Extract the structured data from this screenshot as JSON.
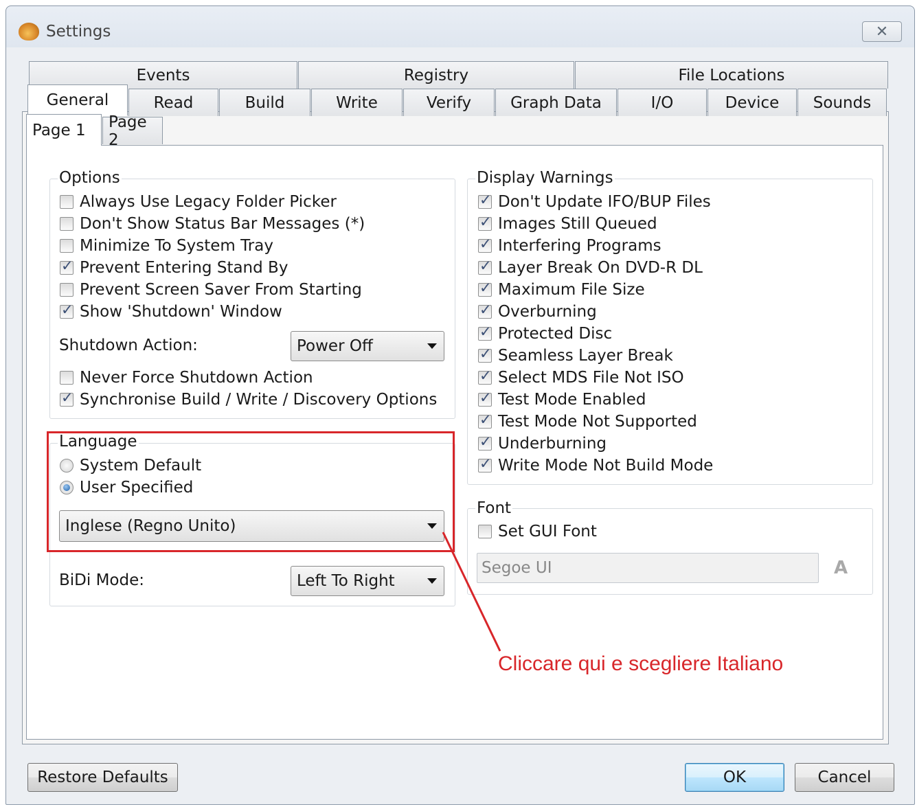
{
  "window": {
    "title": "Settings"
  },
  "tabs_row1": [
    "Events",
    "Registry",
    "File Locations"
  ],
  "tabs_row2": [
    "General",
    "Read",
    "Build",
    "Write",
    "Verify",
    "Graph Data",
    "I/O",
    "Device",
    "Sounds"
  ],
  "subtabs": [
    "Page 1",
    "Page 2"
  ],
  "options": {
    "title": "Options",
    "items": [
      {
        "label": "Always Use Legacy Folder Picker",
        "checked": false
      },
      {
        "label": "Don't Show Status Bar Messages (*)",
        "checked": false
      },
      {
        "label": "Minimize To System Tray",
        "checked": false
      },
      {
        "label": "Prevent Entering Stand By",
        "checked": true
      },
      {
        "label": "Prevent Screen Saver From Starting",
        "checked": false
      },
      {
        "label": "Show 'Shutdown' Window",
        "checked": true
      }
    ],
    "shutdown_label": "Shutdown Action:",
    "shutdown_value": "Power Off",
    "items2": [
      {
        "label": "Never Force Shutdown Action",
        "checked": false
      },
      {
        "label": "Synchronise Build / Write / Discovery Options",
        "checked": true
      }
    ]
  },
  "language": {
    "title": "Language",
    "system_default": "System Default",
    "user_specified": "User Specified",
    "selected": "user_specified",
    "value": "Inglese (Regno Unito)",
    "bidi_label": "BiDi Mode:",
    "bidi_value": "Left To Right"
  },
  "warnings": {
    "title": "Display Warnings",
    "items": [
      "Don't Update IFO/BUP Files",
      "Images Still Queued",
      "Interfering Programs",
      "Layer Break On DVD-R DL",
      "Maximum File Size",
      "Overburning",
      "Protected Disc",
      "Seamless Layer Break",
      "Select MDS File Not ISO",
      "Test Mode Enabled",
      "Test Mode Not Supported",
      "Underburning",
      "Write Mode Not Build Mode"
    ]
  },
  "font": {
    "title": "Font",
    "set_gui_font": "Set GUI Font",
    "set_gui_font_checked": false,
    "font_name": "Segoe UI"
  },
  "annotation": "Cliccare qui e scegliere Italiano",
  "buttons": {
    "restore": "Restore Defaults",
    "ok": "OK",
    "cancel": "Cancel"
  },
  "glyphs": {
    "close": "✕",
    "font_icon": "A"
  },
  "colors": {
    "annotation_red": "#d8262a",
    "ok_blue": "#bee6fd"
  }
}
